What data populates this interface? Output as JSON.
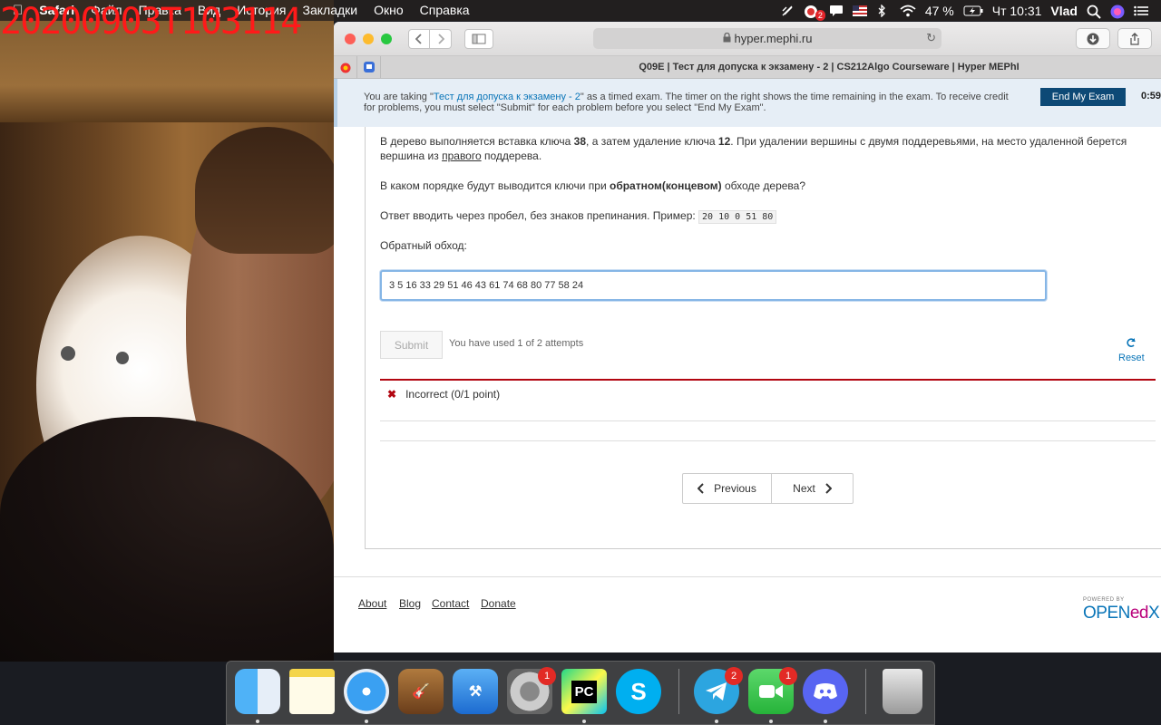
{
  "overlay": {
    "timestamp": "20200903T103114"
  },
  "menubar": {
    "apple": "",
    "items": [
      "Safari",
      "Файл",
      "Правка",
      "Вид",
      "История",
      "Закладки",
      "Окно",
      "Справка"
    ],
    "notification_badge": "2",
    "battery": "47 %",
    "clock": "Чт 10:31",
    "user": "Vlad"
  },
  "browser": {
    "url": "hyper.mephi.ru",
    "tab_title": "Q09E | Тест для допуска к экзамену - 2 | CS212Algo Courseware | Hyper MEPhI"
  },
  "banner": {
    "text_before": "You are taking \"",
    "exam_link": "Тест для допуска к экзамену - 2",
    "text_after": "\" as a timed exam. The timer on the right shows the time remaining in the exam. To receive credit for problems, you must select \"Submit\" for each problem before you select \"End My Exam\".",
    "end_button": "End My Exam",
    "timer": "0:59:"
  },
  "problem": {
    "p1_a": "В дерево выполняется вставка ключа ",
    "p1_key1": "38",
    "p1_b": ", а затем удаление ключа ",
    "p1_key2": "12",
    "p1_c": ". При удалении вершины с двумя поддеревьями, на место удаленной берется вершина из ",
    "p1_u": "правого",
    "p1_d": " поддерева.",
    "p2_a": "В каком порядке будут выводится ключи при ",
    "p2_b": "обратном(концевом)",
    "p2_c": " обходе дерева?",
    "p3": "Ответ вводить через пробел, без знаков препинания. Пример: ",
    "p3_code": "20 10 0 51 80",
    "label": "Обратный обход:",
    "answer_value": "3 5 16 33 29 51 46 43 61 74 68 80 77 58 24",
    "submit": "Submit",
    "attempts": "You have used 1 of 2 attempts",
    "reset": "Reset",
    "status": "Incorrect (0/1 point)",
    "status_icon": "✖",
    "prev": "Previous",
    "next": "Next"
  },
  "footer": {
    "links": [
      "About",
      "Blog",
      "Contact",
      "Donate"
    ],
    "powered_by": "POWERED BY",
    "logo_open": "OPEN",
    "logo_ed": "ed",
    "logo_x": "X"
  },
  "dock": {
    "apps": [
      {
        "name": "Finder"
      },
      {
        "name": "Notes"
      },
      {
        "name": "Safari"
      },
      {
        "name": "GarageBand"
      },
      {
        "name": "Xcode"
      },
      {
        "name": "System Preferences",
        "badge": "1"
      },
      {
        "name": "PyCharm",
        "label": "PC"
      },
      {
        "name": "Skype"
      },
      {
        "name": "Telegram",
        "badge": "2"
      },
      {
        "name": "FaceTime",
        "badge": "1"
      },
      {
        "name": "Discord"
      },
      {
        "name": "Trash"
      }
    ]
  },
  "colors": {
    "accent": "#0a75b8",
    "end_exam": "#0d4976",
    "error": "#b20610",
    "stamp": "#ff1a1a"
  }
}
